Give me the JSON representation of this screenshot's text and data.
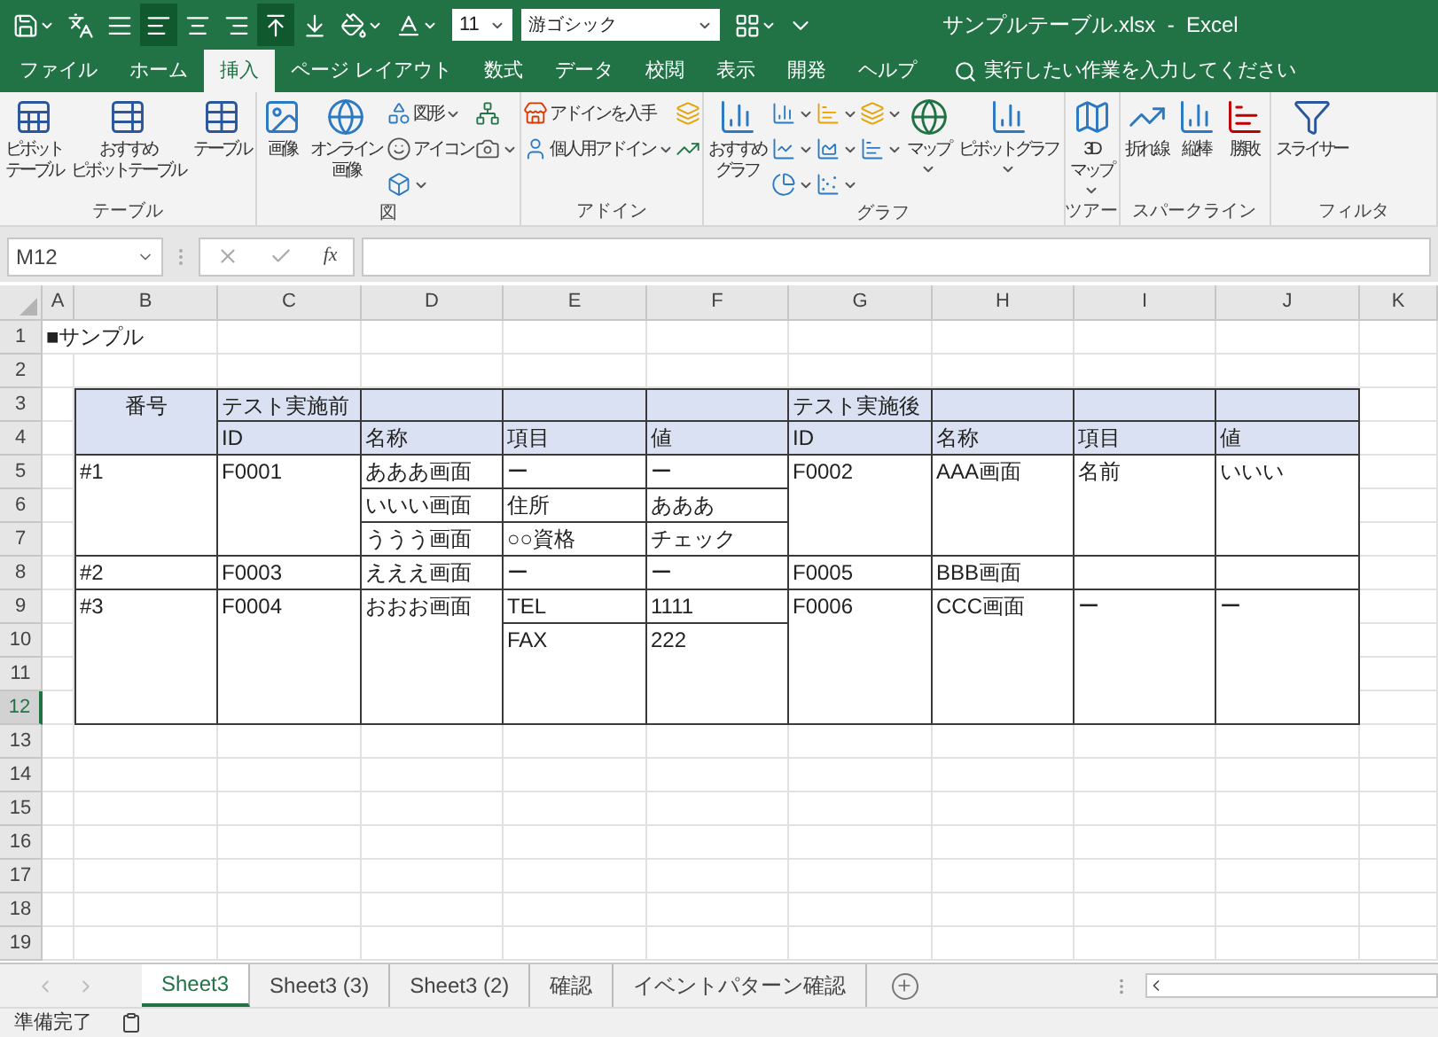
{
  "title_bar": {
    "quick_access": [
      {
        "menu": true,
        "pressed": false
      },
      {
        "menu": false,
        "pressed": false
      },
      {
        "menu": false,
        "pressed": false
      },
      {
        "menu": false,
        "pressed": true
      },
      {
        "menu": false,
        "pressed": false
      },
      {
        "menu": false,
        "pressed": false
      },
      {
        "menu": false,
        "pressed": true
      },
      {
        "menu": false,
        "pressed": false
      },
      {
        "menu": true,
        "pressed": false
      },
      {
        "menu": true,
        "pressed": false
      }
    ],
    "font_size": "11",
    "font_name": "游ゴシック",
    "quick_access_after": [
      {
        "menu": true,
        "pressed": false
      },
      {
        "menu": false,
        "pressed": false
      }
    ],
    "title": "サンプルテーブル.xlsx  -  Excel"
  },
  "tabs": [
    {
      "label": "ファイル",
      "selected": false
    },
    {
      "label": "ホーム",
      "selected": false
    },
    {
      "label": "挿入",
      "selected": true
    },
    {
      "label": "ページ レイアウト",
      "selected": false
    },
    {
      "label": "数式",
      "selected": false
    },
    {
      "label": "データ",
      "selected": false
    },
    {
      "label": "校閲",
      "selected": false
    },
    {
      "label": "表示",
      "selected": false
    },
    {
      "label": "開発",
      "selected": false
    },
    {
      "label": "ヘルプ",
      "selected": false
    }
  ],
  "tell_me": {
    "placeholder": "実行したい作業を入力してください"
  },
  "ribbon": {
    "groups": [
      {
        "label": "テーブル",
        "items": [
          {
            "kind": "large",
            "lines": [
              "ピボット",
              "テーブル"
            ],
            "menu": false
          },
          {
            "kind": "large",
            "lines": [
              "おすすめ",
              "ピボットテーブル"
            ],
            "menu": false
          },
          {
            "kind": "large",
            "lines": [
              "テーブル"
            ],
            "menu": false
          }
        ]
      },
      {
        "label": "図",
        "items": [
          {
            "kind": "large",
            "lines": [
              "画像"
            ],
            "menu": false
          },
          {
            "kind": "large",
            "lines": [
              "オンライン",
              "画像"
            ],
            "menu": false
          },
          {
            "kind": "stack",
            "items": [
              {
                "label": "図形",
                "menu": true
              },
              {
                "label": "アイコン",
                "menu": false
              },
              {
                "menu": true
              }
            ]
          },
          {
            "kind": "stack",
            "items": [
              {
                "menu": false
              },
              {
                "menu": true
              }
            ]
          }
        ]
      },
      {
        "label": "アドイン",
        "items": [
          {
            "kind": "stack",
            "items": [
              {
                "label": "アドインを入手",
                "menu": false
              },
              {
                "label": "個人用アドイン",
                "menu": true
              }
            ]
          },
          {
            "kind": "stack",
            "items": [
              {
                "menu": false
              },
              {
                "menu": false
              }
            ]
          }
        ]
      },
      {
        "label": "グラフ",
        "items": [
          {
            "kind": "large",
            "lines": [
              "おすすめ",
              "グラフ"
            ],
            "menu": false
          },
          {
            "kind": "stack",
            "items": [
              {
                "menu": true
              },
              {
                "menu": true
              },
              {
                "menu": true
              }
            ]
          },
          {
            "kind": "stack",
            "items": [
              {
                "menu": true
              },
              {
                "menu": true
              },
              {
                "menu": true
              }
            ]
          },
          {
            "kind": "stack",
            "items": [
              {
                "menu": true
              },
              {
                "menu": true
              }
            ]
          },
          {
            "kind": "large",
            "lines": [
              "マップ"
            ],
            "menu": true
          },
          {
            "kind": "large",
            "lines": [
              "ピボットグラフ"
            ],
            "menu": true
          }
        ]
      },
      {
        "label": "ツアー",
        "items": [
          {
            "kind": "large",
            "lines": [
              "3D",
              "マップ"
            ],
            "menu": true
          }
        ]
      },
      {
        "label": "スパークライン",
        "items": [
          {
            "kind": "large",
            "lines": [
              "折れ線"
            ],
            "menu": false
          },
          {
            "kind": "large",
            "lines": [
              "縦棒"
            ],
            "menu": false
          },
          {
            "kind": "large",
            "lines": [
              "勝敗"
            ],
            "menu": false
          }
        ]
      },
      {
        "label": "フィルタ",
        "items": [
          {
            "kind": "large",
            "lines": [
              "スライサー"
            ],
            "menu": false
          }
        ]
      }
    ]
  },
  "formula_bar": {
    "name_box": "M12",
    "fx": "fx"
  },
  "sheet": {
    "column_headers": [
      "A",
      "B",
      "C",
      "D",
      "E",
      "F",
      "G",
      "H",
      "I",
      "J",
      "K"
    ],
    "row_headers": [
      {
        "label": "1",
        "selected": false
      },
      {
        "label": "2",
        "selected": false
      },
      {
        "label": "3",
        "selected": false
      },
      {
        "label": "4",
        "selected": false
      },
      {
        "label": "5",
        "selected": false
      },
      {
        "label": "6",
        "selected": false
      },
      {
        "label": "7",
        "selected": false
      },
      {
        "label": "8",
        "selected": false
      },
      {
        "label": "9",
        "selected": false
      },
      {
        "label": "10",
        "selected": false
      },
      {
        "label": "11",
        "selected": false
      },
      {
        "label": "12",
        "selected": true
      },
      {
        "label": "13",
        "selected": false
      },
      {
        "label": "14",
        "selected": false
      },
      {
        "label": "15",
        "selected": false
      },
      {
        "label": "16",
        "selected": false
      },
      {
        "label": "17",
        "selected": false
      },
      {
        "label": "18",
        "selected": false
      },
      {
        "label": "19",
        "selected": false
      }
    ],
    "title_cell": "■サンプル",
    "table_cells": [
      "番号",
      "テスト実施前",
      "テスト実施後",
      "ID",
      "名称",
      "項目",
      "値",
      "ID",
      "名称",
      "項目",
      "値",
      "#1",
      "F0001",
      "あああ画面",
      "ー",
      "ー",
      "F0002",
      "AAA画面",
      "名前",
      "いいい",
      "いいい画面",
      "住所",
      "あああ",
      "ううう画面",
      "○○資格",
      "チェック",
      "#2",
      "F0003",
      "えええ画面",
      "ー",
      "ー",
      "F0005",
      "BBB画面",
      "#3",
      "F0004",
      "おおお画面",
      "TEL",
      "1111",
      "F0006",
      "CCC画面",
      "ー",
      "ー",
      "FAX",
      "222"
    ]
  },
  "sheet_tabs": [
    {
      "label": "Sheet3",
      "selected": true
    },
    {
      "label": "Sheet3 (3)",
      "selected": false
    },
    {
      "label": "Sheet3 (2)",
      "selected": false
    },
    {
      "label": "確認",
      "selected": false
    },
    {
      "label": "イベントパターン確認",
      "selected": false
    }
  ],
  "status_bar": {
    "text": "準備完了"
  }
}
